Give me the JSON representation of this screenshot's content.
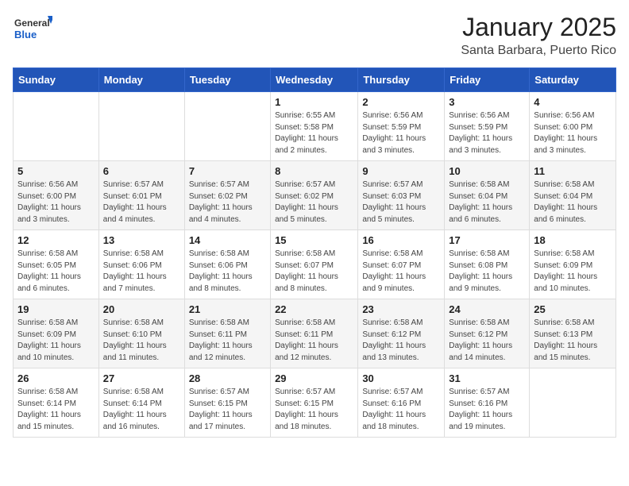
{
  "header": {
    "logo_general": "General",
    "logo_blue": "Blue",
    "month_title": "January 2025",
    "location": "Santa Barbara, Puerto Rico"
  },
  "days_of_week": [
    "Sunday",
    "Monday",
    "Tuesday",
    "Wednesday",
    "Thursday",
    "Friday",
    "Saturday"
  ],
  "weeks": [
    [
      {
        "day": "",
        "info": ""
      },
      {
        "day": "",
        "info": ""
      },
      {
        "day": "",
        "info": ""
      },
      {
        "day": "1",
        "info": "Sunrise: 6:55 AM\nSunset: 5:58 PM\nDaylight: 11 hours and 2 minutes."
      },
      {
        "day": "2",
        "info": "Sunrise: 6:56 AM\nSunset: 5:59 PM\nDaylight: 11 hours and 3 minutes."
      },
      {
        "day": "3",
        "info": "Sunrise: 6:56 AM\nSunset: 5:59 PM\nDaylight: 11 hours and 3 minutes."
      },
      {
        "day": "4",
        "info": "Sunrise: 6:56 AM\nSunset: 6:00 PM\nDaylight: 11 hours and 3 minutes."
      }
    ],
    [
      {
        "day": "5",
        "info": "Sunrise: 6:56 AM\nSunset: 6:00 PM\nDaylight: 11 hours and 3 minutes."
      },
      {
        "day": "6",
        "info": "Sunrise: 6:57 AM\nSunset: 6:01 PM\nDaylight: 11 hours and 4 minutes."
      },
      {
        "day": "7",
        "info": "Sunrise: 6:57 AM\nSunset: 6:02 PM\nDaylight: 11 hours and 4 minutes."
      },
      {
        "day": "8",
        "info": "Sunrise: 6:57 AM\nSunset: 6:02 PM\nDaylight: 11 hours and 5 minutes."
      },
      {
        "day": "9",
        "info": "Sunrise: 6:57 AM\nSunset: 6:03 PM\nDaylight: 11 hours and 5 minutes."
      },
      {
        "day": "10",
        "info": "Sunrise: 6:58 AM\nSunset: 6:04 PM\nDaylight: 11 hours and 6 minutes."
      },
      {
        "day": "11",
        "info": "Sunrise: 6:58 AM\nSunset: 6:04 PM\nDaylight: 11 hours and 6 minutes."
      }
    ],
    [
      {
        "day": "12",
        "info": "Sunrise: 6:58 AM\nSunset: 6:05 PM\nDaylight: 11 hours and 6 minutes."
      },
      {
        "day": "13",
        "info": "Sunrise: 6:58 AM\nSunset: 6:06 PM\nDaylight: 11 hours and 7 minutes."
      },
      {
        "day": "14",
        "info": "Sunrise: 6:58 AM\nSunset: 6:06 PM\nDaylight: 11 hours and 8 minutes."
      },
      {
        "day": "15",
        "info": "Sunrise: 6:58 AM\nSunset: 6:07 PM\nDaylight: 11 hours and 8 minutes."
      },
      {
        "day": "16",
        "info": "Sunrise: 6:58 AM\nSunset: 6:07 PM\nDaylight: 11 hours and 9 minutes."
      },
      {
        "day": "17",
        "info": "Sunrise: 6:58 AM\nSunset: 6:08 PM\nDaylight: 11 hours and 9 minutes."
      },
      {
        "day": "18",
        "info": "Sunrise: 6:58 AM\nSunset: 6:09 PM\nDaylight: 11 hours and 10 minutes."
      }
    ],
    [
      {
        "day": "19",
        "info": "Sunrise: 6:58 AM\nSunset: 6:09 PM\nDaylight: 11 hours and 10 minutes."
      },
      {
        "day": "20",
        "info": "Sunrise: 6:58 AM\nSunset: 6:10 PM\nDaylight: 11 hours and 11 minutes."
      },
      {
        "day": "21",
        "info": "Sunrise: 6:58 AM\nSunset: 6:11 PM\nDaylight: 11 hours and 12 minutes."
      },
      {
        "day": "22",
        "info": "Sunrise: 6:58 AM\nSunset: 6:11 PM\nDaylight: 11 hours and 12 minutes."
      },
      {
        "day": "23",
        "info": "Sunrise: 6:58 AM\nSunset: 6:12 PM\nDaylight: 11 hours and 13 minutes."
      },
      {
        "day": "24",
        "info": "Sunrise: 6:58 AM\nSunset: 6:12 PM\nDaylight: 11 hours and 14 minutes."
      },
      {
        "day": "25",
        "info": "Sunrise: 6:58 AM\nSunset: 6:13 PM\nDaylight: 11 hours and 15 minutes."
      }
    ],
    [
      {
        "day": "26",
        "info": "Sunrise: 6:58 AM\nSunset: 6:14 PM\nDaylight: 11 hours and 15 minutes."
      },
      {
        "day": "27",
        "info": "Sunrise: 6:58 AM\nSunset: 6:14 PM\nDaylight: 11 hours and 16 minutes."
      },
      {
        "day": "28",
        "info": "Sunrise: 6:57 AM\nSunset: 6:15 PM\nDaylight: 11 hours and 17 minutes."
      },
      {
        "day": "29",
        "info": "Sunrise: 6:57 AM\nSunset: 6:15 PM\nDaylight: 11 hours and 18 minutes."
      },
      {
        "day": "30",
        "info": "Sunrise: 6:57 AM\nSunset: 6:16 PM\nDaylight: 11 hours and 18 minutes."
      },
      {
        "day": "31",
        "info": "Sunrise: 6:57 AM\nSunset: 6:16 PM\nDaylight: 11 hours and 19 minutes."
      },
      {
        "day": "",
        "info": ""
      }
    ]
  ]
}
